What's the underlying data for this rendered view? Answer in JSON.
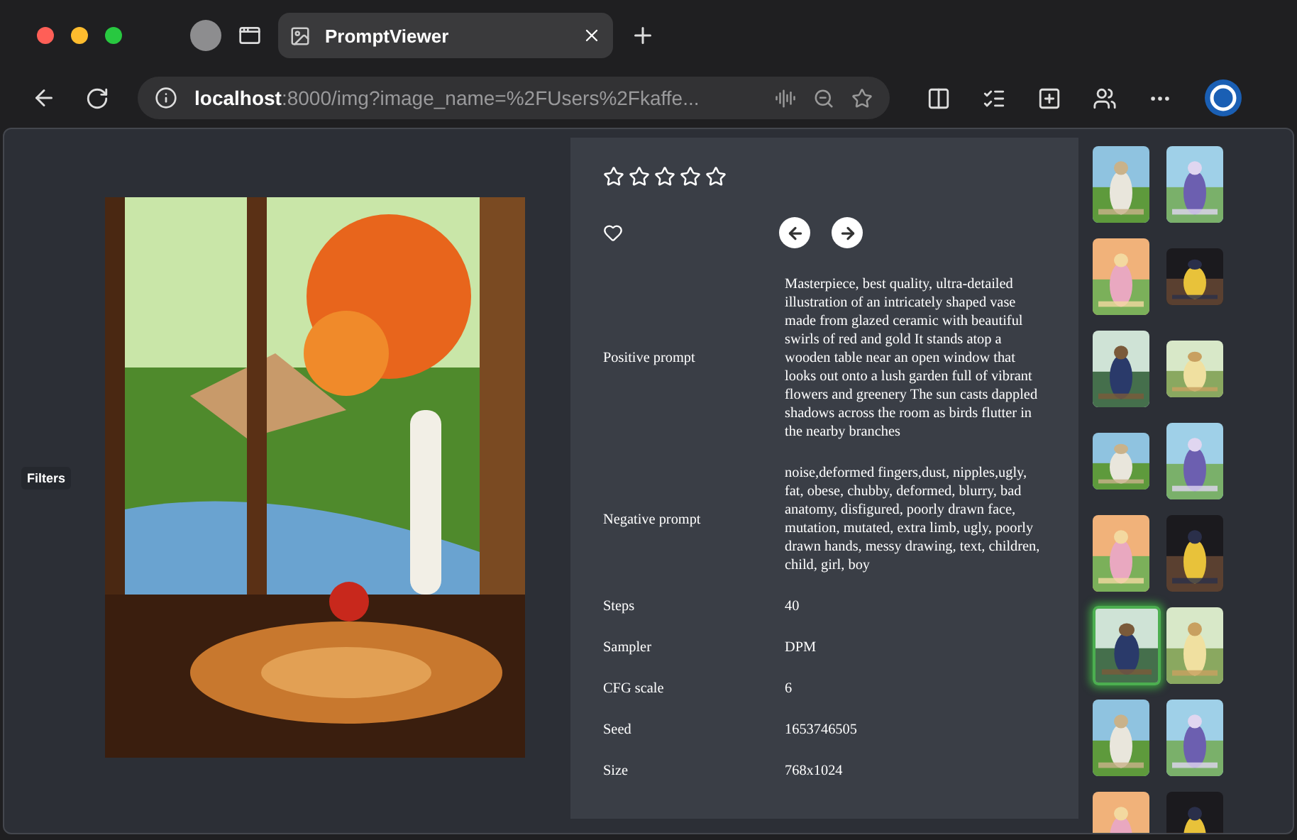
{
  "browser": {
    "tab_title": "PromptViewer",
    "url_host": "localhost",
    "url_rest": ":8000/img?image_name=%2FUsers%2Fkaffe..."
  },
  "filters_tab": {
    "label": "Filters"
  },
  "image": {
    "kind": "picture"
  },
  "details": {
    "stars": 0,
    "favorited": false,
    "rows": [
      {
        "label": "Positive prompt",
        "value": "Masterpiece, best quality, ultra-detailed illustration of an intricately shaped vase made from glazed ceramic with beautiful swirls of red and gold It stands atop a wooden table near an open window that looks out onto a lush garden full of vibrant flowers and greenery The sun casts dappled shadows across the room as birds flutter in the nearby branches"
      },
      {
        "label": "Negative prompt",
        "value": "noise,deformed fingers,dust, nipples,ugly, fat, obese, chubby, deformed, blurry, bad anatomy, disfigured, poorly drawn face, mutation, mutated, extra limb, ugly, poorly drawn hands, messy drawing, text, children, child, girl, boy"
      },
      {
        "label": "Steps",
        "value": "40"
      },
      {
        "label": "Sampler",
        "value": "DPM"
      },
      {
        "label": "CFG scale",
        "value": "6"
      },
      {
        "label": "Seed",
        "value": "1653746505"
      },
      {
        "label": "Size",
        "value": "768x1024"
      }
    ]
  },
  "thumbnails": [
    {
      "kind": "picture",
      "selected": false
    },
    {
      "kind": "picture",
      "selected": false
    },
    {
      "kind": "picture",
      "selected": false
    },
    {
      "kind": "picture",
      "selected": false
    },
    {
      "kind": "picture",
      "selected": false
    },
    {
      "kind": "picture",
      "selected": false
    },
    {
      "kind": "picture",
      "selected": false
    },
    {
      "kind": "picture",
      "selected": false
    },
    {
      "kind": "picture",
      "selected": false
    },
    {
      "kind": "picture",
      "selected": false
    },
    {
      "kind": "picture",
      "selected": true
    },
    {
      "kind": "picture",
      "selected": false
    },
    {
      "kind": "picture",
      "selected": false
    },
    {
      "kind": "picture",
      "selected": false
    },
    {
      "kind": "picture",
      "selected": false
    },
    {
      "kind": "picture",
      "selected": false
    }
  ]
}
